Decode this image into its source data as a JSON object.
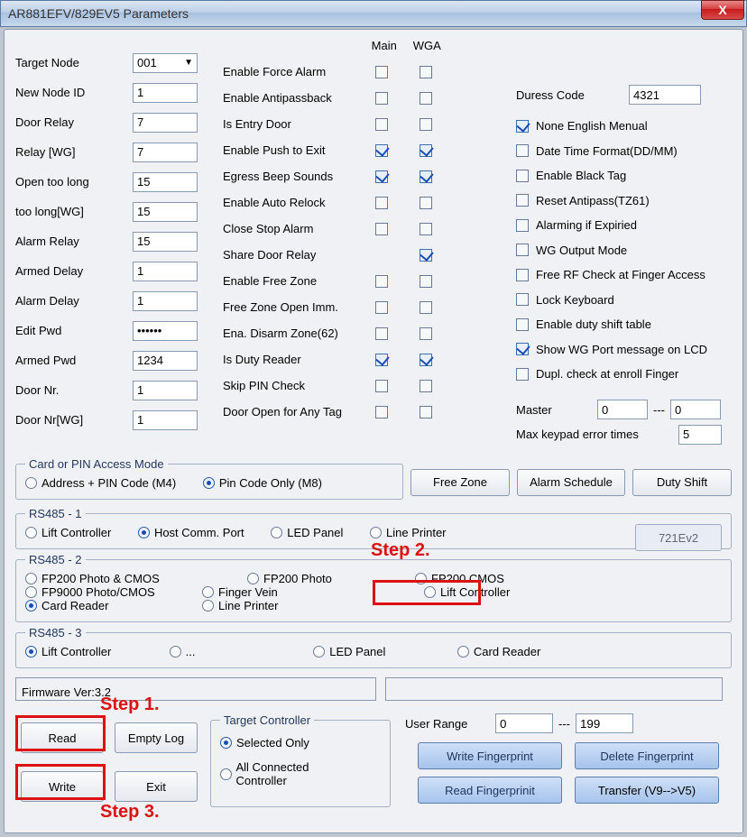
{
  "window": {
    "title": "AR881EFV/829EV5 Parameters",
    "close_glyph": "X"
  },
  "left": {
    "target_node_label": "Target Node",
    "target_node_value": "001",
    "new_node_id_label": "New Node ID",
    "new_node_id_value": "1",
    "door_relay_label": "Door Relay",
    "door_relay_value": "7",
    "relay_wg_label": "Relay [WG]",
    "relay_wg_value": "7",
    "open_too_long_label": "Open too long",
    "open_too_long_value": "15",
    "too_long_wg_label": "too long[WG]",
    "too_long_wg_value": "15",
    "alarm_relay_label": "Alarm Relay",
    "alarm_relay_value": "15",
    "armed_delay_label": "Armed Delay",
    "armed_delay_value": "1",
    "alarm_delay_label": "Alarm Delay",
    "alarm_delay_value": "1",
    "edit_pwd_label": "Edit Pwd",
    "edit_pwd_value": "••••••",
    "armed_pwd_label": "Armed Pwd",
    "armed_pwd_value": "1234",
    "door_nr_label": "Door Nr.",
    "door_nr_value": "1",
    "door_nr_wg_label": "Door Nr[WG]",
    "door_nr_wg_value": "1"
  },
  "mid": {
    "hdr_main": "Main",
    "hdr_wga": "WGA",
    "items": [
      {
        "label": "Enable Force Alarm",
        "main": false,
        "wga": false
      },
      {
        "label": "Enable Antipassback",
        "main": false,
        "wga": false
      },
      {
        "label": "Is Entry Door",
        "main": false,
        "wga": false
      },
      {
        "label": "Enable Push to Exit",
        "main": true,
        "wga": true
      },
      {
        "label": "Egress Beep Sounds",
        "main": true,
        "wga": true
      },
      {
        "label": "Enable Auto Relock",
        "main": false,
        "wga": false
      },
      {
        "label": "Close Stop Alarm",
        "main": false,
        "wga": false
      },
      {
        "label": "Share Door Relay",
        "main": null,
        "wga": true
      },
      {
        "label": "Enable Free Zone",
        "main": false,
        "wga": false
      },
      {
        "label": "Free Zone Open Imm.",
        "main": false,
        "wga": false
      },
      {
        "label": "Ena. Disarm Zone(62)",
        "main": false,
        "wga": false
      },
      {
        "label": "Is Duty Reader",
        "main": true,
        "wga": true
      },
      {
        "label": "Skip PIN Check",
        "main": false,
        "wga": false
      },
      {
        "label": "Door Open for Any Tag",
        "main": false,
        "wga": false
      }
    ]
  },
  "right": {
    "duress_label": "Duress Code",
    "duress_value": "4321",
    "items": [
      {
        "label": "None English Menual",
        "on": true
      },
      {
        "label": "Date Time Format(DD/MM)",
        "on": false
      },
      {
        "label": "Enable Black Tag",
        "on": false
      },
      {
        "label": "Reset Antipass(TZ61)",
        "on": false
      },
      {
        "label": "Alarming if Expiried",
        "on": false
      },
      {
        "label": "WG Output Mode",
        "on": false
      },
      {
        "label": "Free RF Check at Finger Access",
        "on": false
      },
      {
        "label": "Lock Keyboard",
        "on": false
      },
      {
        "label": "Enable duty shift table",
        "on": false
      },
      {
        "label": "Show WG Port message on LCD",
        "on": true
      },
      {
        "label": "Dupl. check at enroll  Finger",
        "on": false
      }
    ],
    "master_label": "Master",
    "master_a": "0",
    "master_sep": "---",
    "master_b": "0",
    "max_err_label": "Max keypad error times",
    "max_err_value": "5"
  },
  "access": {
    "legend": "Card or PIN Access Mode",
    "opt_a": "Address + PIN Code (M4)",
    "opt_b": "Pin Code Only (M8)",
    "free_zone_btn": "Free Zone",
    "alarm_sched_btn": "Alarm Schedule",
    "duty_shift_btn": "Duty Shift"
  },
  "rs1": {
    "legend": "RS485 - 1",
    "lift": "Lift Controller",
    "host": "Host Comm. Port",
    "led": "LED Panel",
    "line": "Line Printer",
    "btn": "721Ev2"
  },
  "rs2": {
    "legend": "RS485 - 2",
    "fp200pc": "FP200 Photo & CMOS",
    "fp200p": "FP200 Photo",
    "fp200c": "FP200 CMOS",
    "fp9000": "FP9000 Photo/CMOS",
    "fv": "Finger Vein",
    "lift": "Lift Controller",
    "card": "Card Reader",
    "line": "Line Printer"
  },
  "rs3": {
    "legend": "RS485 - 3",
    "lift": "Lift Controller",
    "dots": "...",
    "led": "LED Panel",
    "card": "Card Reader"
  },
  "fw": {
    "label": "Firmware Ver:3.2"
  },
  "bottom": {
    "read": "Read",
    "empty_log": "Empty Log",
    "write": "Write",
    "exit": "Exit",
    "tc_legend": "Target Controller",
    "tc_sel": "Selected Only",
    "tc_all": "All Connected Controller",
    "user_range_label": "User Range",
    "ur_from": "0",
    "ur_dash": "---",
    "ur_to": "199",
    "wfp": "Write Fingerprint",
    "dfp": "Delete Fingerprint",
    "rfp": "Read Fingerprinit",
    "tfp": "Transfer (V9-->V5)"
  },
  "annot": {
    "step1": "Step 1.",
    "step2": "Step 2.",
    "step3": "Step 3."
  }
}
